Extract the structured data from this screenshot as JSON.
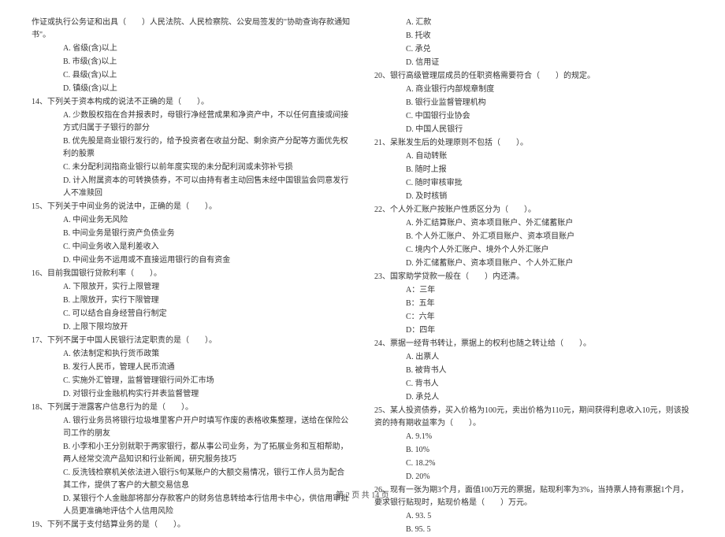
{
  "page_footer": "第 2 页 共 14 页",
  "left_col": [
    {
      "ind": 0,
      "t": "作证或执行公务证和出具（　　）人民法院、人民检察院、公安局签发的\"协助查询存款通知书\"。"
    },
    {
      "ind": 2,
      "t": "A. 省级(含)以上"
    },
    {
      "ind": 2,
      "t": "B. 市级(含)以上"
    },
    {
      "ind": 2,
      "t": "C. 县级(含)以上"
    },
    {
      "ind": 2,
      "t": "D. 镇级(含)以上"
    },
    {
      "ind": 0,
      "t": "14、下列关于资本构成的说法不正确的是（　　）。"
    },
    {
      "ind": 2,
      "t": "A. 少数股权指在合并报表时，母银行净经营成果和净资产中，不以任何直接或间接方式归属于子银行的部分"
    },
    {
      "ind": 2,
      "t": "B. 优先股是商业银行发行的，给予投资者在收益分配、剩余资产分配等方面优先权利的股票"
    },
    {
      "ind": 2,
      "t": "C. 未分配利润指商业银行以前年度实现的未分配利润或未弥补亏损"
    },
    {
      "ind": 2,
      "t": "D. 计入附属资本的可转换债券，不可以由持有者主动回售未经中国银监会同意发行人不准赎回"
    },
    {
      "ind": 0,
      "t": "15、下列关于中间业务的说法中，正确的是（　　）。"
    },
    {
      "ind": 2,
      "t": "A. 中间业务无风险"
    },
    {
      "ind": 2,
      "t": "B. 中间业务是银行资产负债业务"
    },
    {
      "ind": 2,
      "t": "C. 中间业务收入是利差收入"
    },
    {
      "ind": 2,
      "t": "D. 中间业务不运用或不直接运用银行的自有资金"
    },
    {
      "ind": 0,
      "t": "16、目前我国银行贷款利率（　　）。"
    },
    {
      "ind": 2,
      "t": "A. 下限放开，实行上限管理"
    },
    {
      "ind": 2,
      "t": "B. 上限放开，实行下限管理"
    },
    {
      "ind": 2,
      "t": "C. 可以结合自身经营自行制定"
    },
    {
      "ind": 2,
      "t": "D. 上限下限均放开"
    },
    {
      "ind": 0,
      "t": "17、下列不属于中国人民银行法定职责的是（　　）。"
    },
    {
      "ind": 2,
      "t": "A. 依法制定和执行货币政策"
    },
    {
      "ind": 2,
      "t": "B. 发行人民币，管理人民币流通"
    },
    {
      "ind": 2,
      "t": "C. 实施外汇管理，监督管理银行间外汇市场"
    },
    {
      "ind": 2,
      "t": "D. 对银行业金融机构实行并表监督管理"
    },
    {
      "ind": 0,
      "t": "18、下列属于泄露客户信息行为的是（　　）。"
    },
    {
      "ind": 2,
      "t": "A. 银行业务员将银行垃圾堆里客户开户时填写作废的表格收集整理，送给在保险公司工作的朋友"
    },
    {
      "ind": 2,
      "t": "B. 小李和小王分别就职于两家银行，都从事公司业务，为了拓展业务和互相帮助，两人经常交流产品知识和行业新闻，研究服务技巧"
    },
    {
      "ind": 2,
      "t": "C. 反洗钱检察机关依法进入银行S旬某账户的大额交易情况，银行工作人员为配合其工作，提供了客户的大额交易信息"
    },
    {
      "ind": 2,
      "t": "D. 某银行个人金融部将部分存款客户的财务信息转给本行信用卡中心，供信用审批人员更准确地评估个人信用风险"
    },
    {
      "ind": 0,
      "t": "19、下列不属于支付结算业务的是（　　）。"
    }
  ],
  "right_col": [
    {
      "ind": 2,
      "t": "A. 汇款"
    },
    {
      "ind": 2,
      "t": "B. 托收"
    },
    {
      "ind": 2,
      "t": "C. 承兑"
    },
    {
      "ind": 2,
      "t": "D. 信用证"
    },
    {
      "ind": 0,
      "t": "20、银行高级管理层成员的任职资格需要符合（　　）的规定。"
    },
    {
      "ind": 2,
      "t": "A. 商业银行内部规章制度"
    },
    {
      "ind": 2,
      "t": "B. 银行业监督管理机构"
    },
    {
      "ind": 2,
      "t": "C. 中国银行业协会"
    },
    {
      "ind": 2,
      "t": "D. 中国人民银行"
    },
    {
      "ind": 0,
      "t": "21、呆账发生后的处理原则不包括（　　）。"
    },
    {
      "ind": 2,
      "t": "A. 自动转账"
    },
    {
      "ind": 2,
      "t": "B. 随时上报"
    },
    {
      "ind": 2,
      "t": "C. 随时审核审批"
    },
    {
      "ind": 2,
      "t": "D. 及时核销"
    },
    {
      "ind": 0,
      "t": "22、个人外汇账户按账户性质区分为（　　）。"
    },
    {
      "ind": 2,
      "t": "A. 外汇结算账户、资本项目账户、外汇储蓄账户"
    },
    {
      "ind": 2,
      "t": "B. 个人外汇账户、 外汇项目账户、资本项目账户"
    },
    {
      "ind": 2,
      "t": "C. 境内个人外汇账户、境外个人外汇账户"
    },
    {
      "ind": 2,
      "t": "D. 外汇储蓄账户、资本项目账户、个人外汇账户"
    },
    {
      "ind": 0,
      "t": "23、国家助学贷款一般在（　　）内还清。"
    },
    {
      "ind": 2,
      "t": "A：三年"
    },
    {
      "ind": 2,
      "t": "B：五年"
    },
    {
      "ind": 2,
      "t": "C：六年"
    },
    {
      "ind": 2,
      "t": "D：四年"
    },
    {
      "ind": 0,
      "t": "24、票据一经背书转让，票据上的权利也随之转让给（　　）。"
    },
    {
      "ind": 2,
      "t": "A. 出票人"
    },
    {
      "ind": 2,
      "t": "B. 被背书人"
    },
    {
      "ind": 2,
      "t": "C. 背书人"
    },
    {
      "ind": 2,
      "t": "D. 承兑人"
    },
    {
      "ind": 0,
      "t": "25、某人投资债券，买入价格为100元，卖出价格为110元，期间获得利息收入10元，则该投资的持有期收益率为（　　）。"
    },
    {
      "ind": 2,
      "t": "A. 9.1%"
    },
    {
      "ind": 2,
      "t": "B. 10%"
    },
    {
      "ind": 2,
      "t": "C. 18.2%"
    },
    {
      "ind": 2,
      "t": "D. 20%"
    },
    {
      "ind": 0,
      "t": "26、现有一张为期3个月，面值100万元的票据，贴现利率为3%，当持票人持有票据1个月，要求银行贴现时，贴现价格是（　　）万元。"
    },
    {
      "ind": 2,
      "t": "A. 93. 5"
    },
    {
      "ind": 2,
      "t": "B. 95. 5"
    }
  ]
}
